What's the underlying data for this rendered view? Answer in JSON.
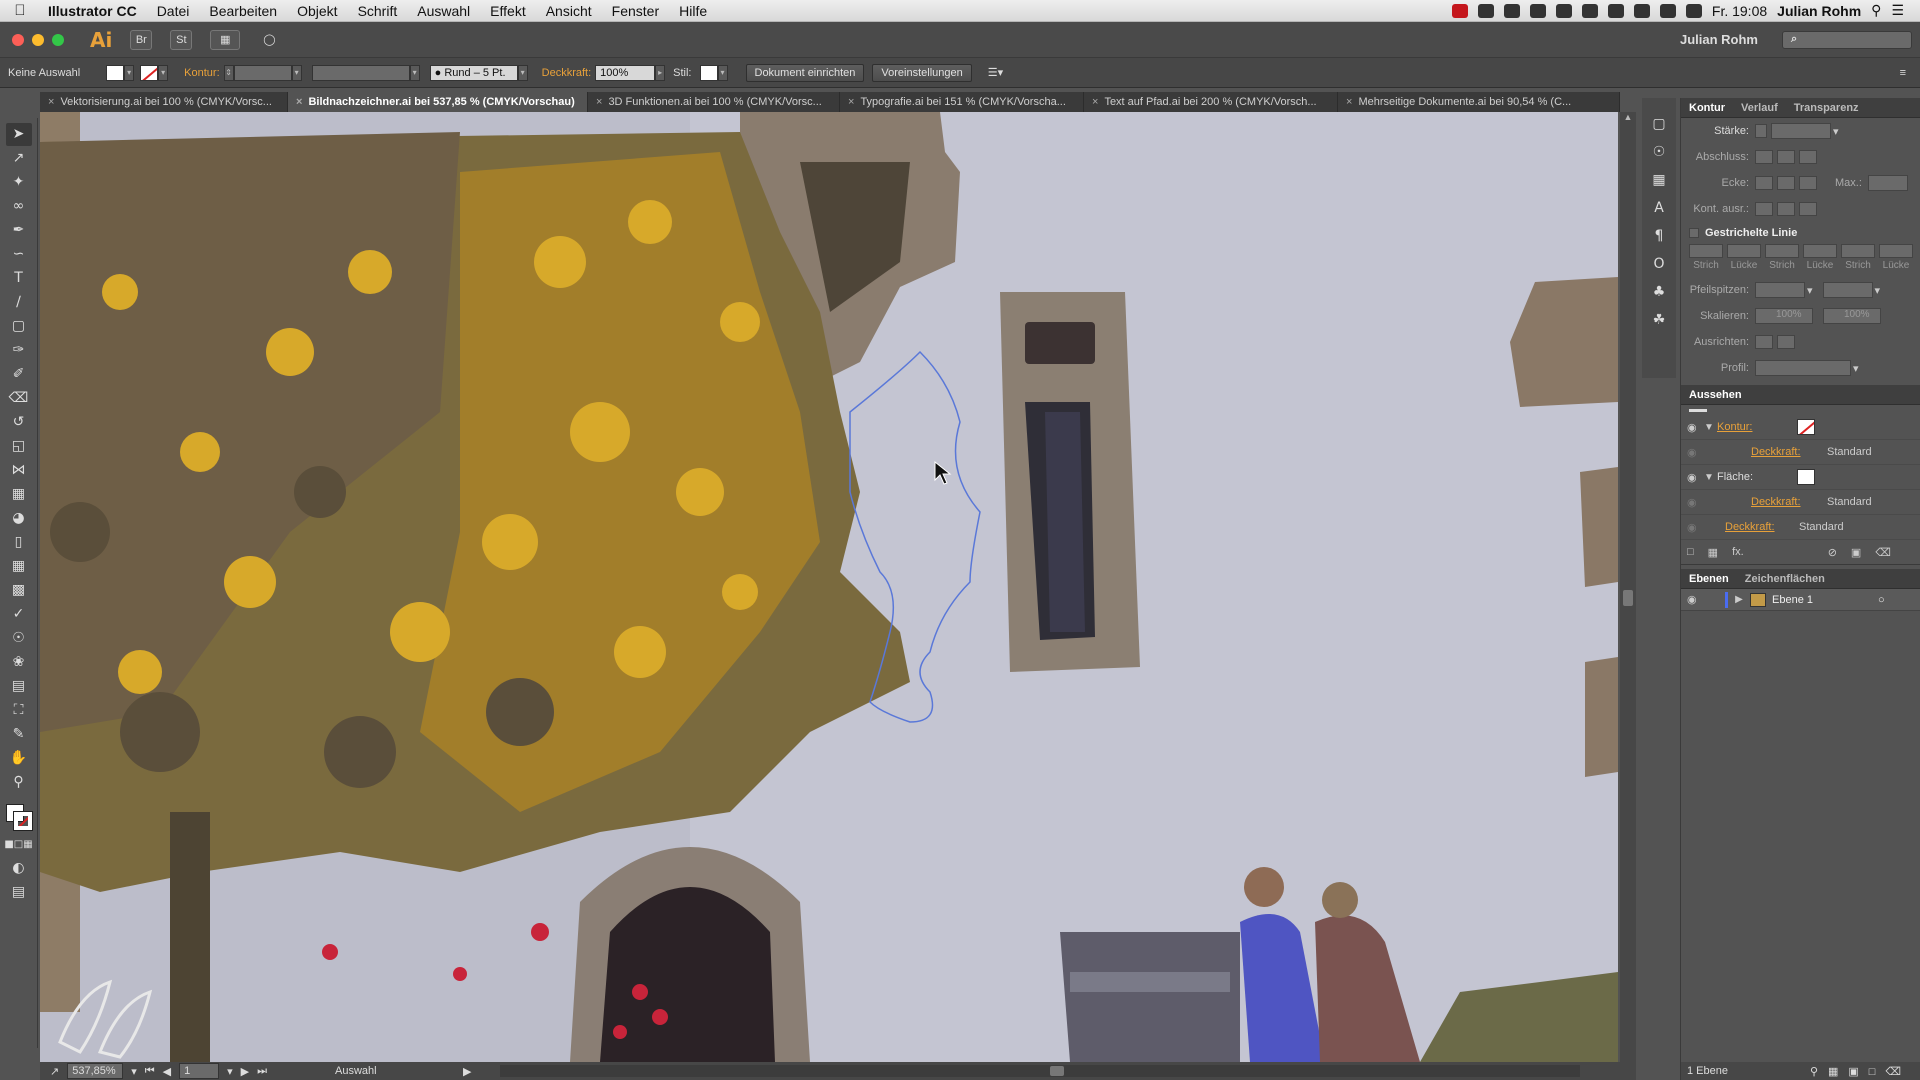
{
  "menubar": {
    "app_name": "Illustrator CC",
    "items": [
      "Datei",
      "Bearbeiten",
      "Objekt",
      "Schrift",
      "Auswahl",
      "Effekt",
      "Ansicht",
      "Fenster",
      "Hilfe"
    ],
    "clock": "Fr. 19:08",
    "user": "Julian Rohm"
  },
  "appbar": {
    "logo": "Ai",
    "btn_br": "Br",
    "btn_st": "St",
    "workspace_user": "Julian Rohm",
    "search_placeholder": "⌕"
  },
  "controlbar": {
    "selection": "Keine Auswahl",
    "kontur_label": "Kontur:",
    "brush": "Rund – 5 Pt.",
    "deckkraft_label": "Deckkraft:",
    "deckkraft_value": "100%",
    "stil_label": "Stil:",
    "doc_setup": "Dokument einrichten",
    "preferences": "Voreinstellungen"
  },
  "tabs": [
    {
      "label": "Vektorisierung.ai bei 100 % (CMYK/Vorsc...",
      "active": false
    },
    {
      "label": "Bildnachzeichner.ai bei 537,85 % (CMYK/Vorschau)",
      "active": true
    },
    {
      "label": "3D Funktionen.ai bei 100 % (CMYK/Vorsc...",
      "active": false
    },
    {
      "label": "Typografie.ai bei 151 % (CMYK/Vorscha...",
      "active": false
    },
    {
      "label": "Text auf Pfad.ai bei 200 % (CMYK/Vorsch...",
      "active": false
    },
    {
      "label": "Mehrseitige Dokumente.ai bei 90,54 % (C...",
      "active": false
    }
  ],
  "status": {
    "zoom": "537,85%",
    "artboard": "1",
    "mode": "Auswahl"
  },
  "panels": {
    "stroke_tabs": [
      "Kontur",
      "Verlauf",
      "Transparenz"
    ],
    "staerke": "Stärke:",
    "abschluss": "Abschluss:",
    "ecke": "Ecke:",
    "max": "Max.:",
    "kont_ausr": "Kont. ausr.:",
    "dashed": "Gestrichelte Linie",
    "dash_labels": [
      "Strich",
      "Lücke",
      "Strich",
      "Lücke",
      "Strich",
      "Lücke"
    ],
    "pfeilspitzen": "Pfeilspitzen:",
    "skalieren": "Skalieren:",
    "skal_1": "100%",
    "skal_2": "100%",
    "ausrichten": "Ausrichten:",
    "profil": "Profil:",
    "aussehen_title": "Aussehen",
    "app_kontur": "Kontur:",
    "app_deckkraft": "Deckkraft:",
    "app_standard": "Standard",
    "app_flaeche": "Fläche:",
    "fx": "fx.",
    "layer_tabs": [
      "Ebenen",
      "Zeichenflächen"
    ],
    "layer_name": "Ebene 1",
    "layer_count": "1 Ebene"
  },
  "colors": {
    "accent": "#e8a13a",
    "canvas_bg": "#bcbcc8",
    "path_blue": "#5a78d8"
  }
}
